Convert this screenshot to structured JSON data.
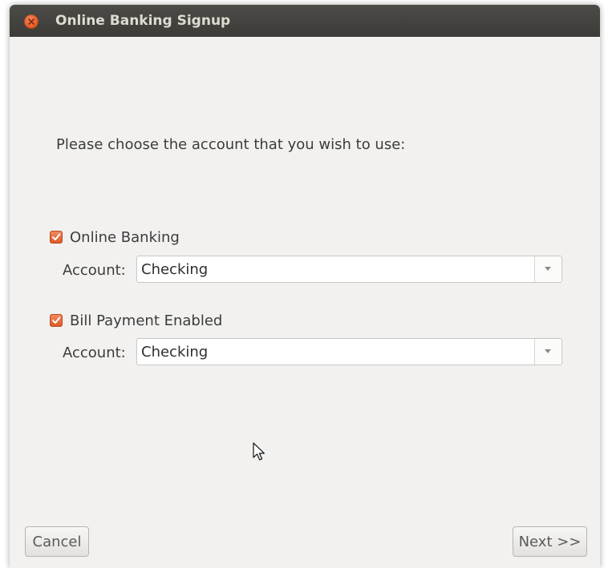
{
  "window": {
    "title": "Online Banking Signup"
  },
  "icons": {
    "close": "close-icon",
    "checkmark": "checkmark-icon",
    "dropdown": "chevron-down-icon",
    "cursor": "mouse-pointer-icon"
  },
  "colors": {
    "accent": "#dd5b2a",
    "titlebar": "#3c3b37",
    "background": "#f2f1f0"
  },
  "prompt": "Please choose the account that you wish to use:",
  "online_banking": {
    "label": "Online Banking",
    "checked": true,
    "account_label": "Account:",
    "account_value": "Checking"
  },
  "bill_payment": {
    "label": "Bill Payment Enabled",
    "checked": true,
    "account_label": "Account:",
    "account_value": "Checking"
  },
  "buttons": {
    "cancel": "Cancel",
    "next": "Next >>"
  }
}
